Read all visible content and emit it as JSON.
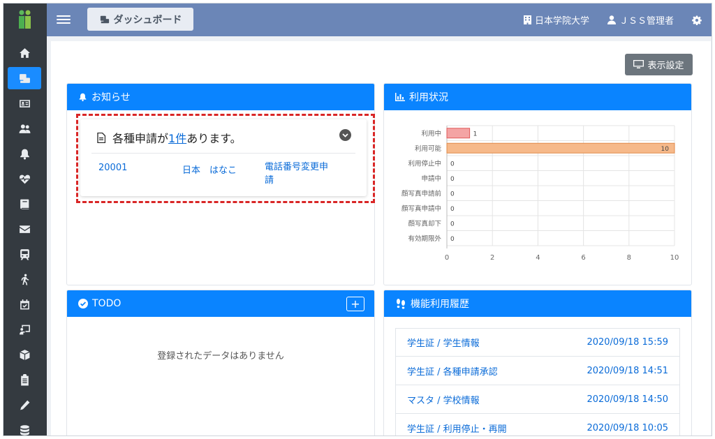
{
  "header": {
    "dashboard_label": "ダッシュボード",
    "university": "日本学院大学",
    "user": "ＪＳＳ管理者"
  },
  "display_settings_label": "表示設定",
  "notice": {
    "title": "お知らせ",
    "message_prefix": "各種申請が",
    "message_link": "1件",
    "message_suffix": "あります。",
    "row": {
      "id": "20001",
      "name": "日本　はなこ",
      "type": "電話番号変更申請"
    }
  },
  "usage": {
    "title": "利用状況"
  },
  "chart_data": {
    "type": "bar",
    "orientation": "horizontal",
    "categories": [
      "利用中",
      "利用可能",
      "利用停止中",
      "申請中",
      "顔写真申請前",
      "顔写真申請中",
      "顔写真却下",
      "有効期限外"
    ],
    "values": [
      1,
      10,
      0,
      0,
      0,
      0,
      0,
      0
    ],
    "xlim": [
      0,
      10
    ],
    "xticks": [
      0,
      2,
      4,
      6,
      8,
      10
    ],
    "grid": true,
    "colors": [
      "#f4a4a4",
      "#f6b98a"
    ]
  },
  "todo": {
    "title": "TODO",
    "add_label": "+",
    "empty_message": "登録されたデータはありません"
  },
  "history": {
    "title": "機能利用履歴",
    "items": [
      {
        "label": "学生証 / 学生情報",
        "time": "2020/09/18 15:59"
      },
      {
        "label": "学生証 / 各種申請承認",
        "time": "2020/09/18 14:51"
      },
      {
        "label": "マスタ / 学校情報",
        "time": "2020/09/18 14:50"
      },
      {
        "label": "学生証 / 利用停止・再開",
        "time": "2020/09/18 10:05"
      }
    ]
  },
  "sidebar": {
    "icons": [
      "home-icon",
      "dashboard-icon",
      "id-card-icon",
      "users-icon",
      "bell-icon",
      "heartbeat-icon",
      "book-icon",
      "mail-icon",
      "train-icon",
      "walking-icon",
      "calendar-check-icon",
      "chalkboard-icon",
      "cube-icon",
      "clipboard-icon",
      "pencil-icon",
      "database-icon"
    ]
  }
}
